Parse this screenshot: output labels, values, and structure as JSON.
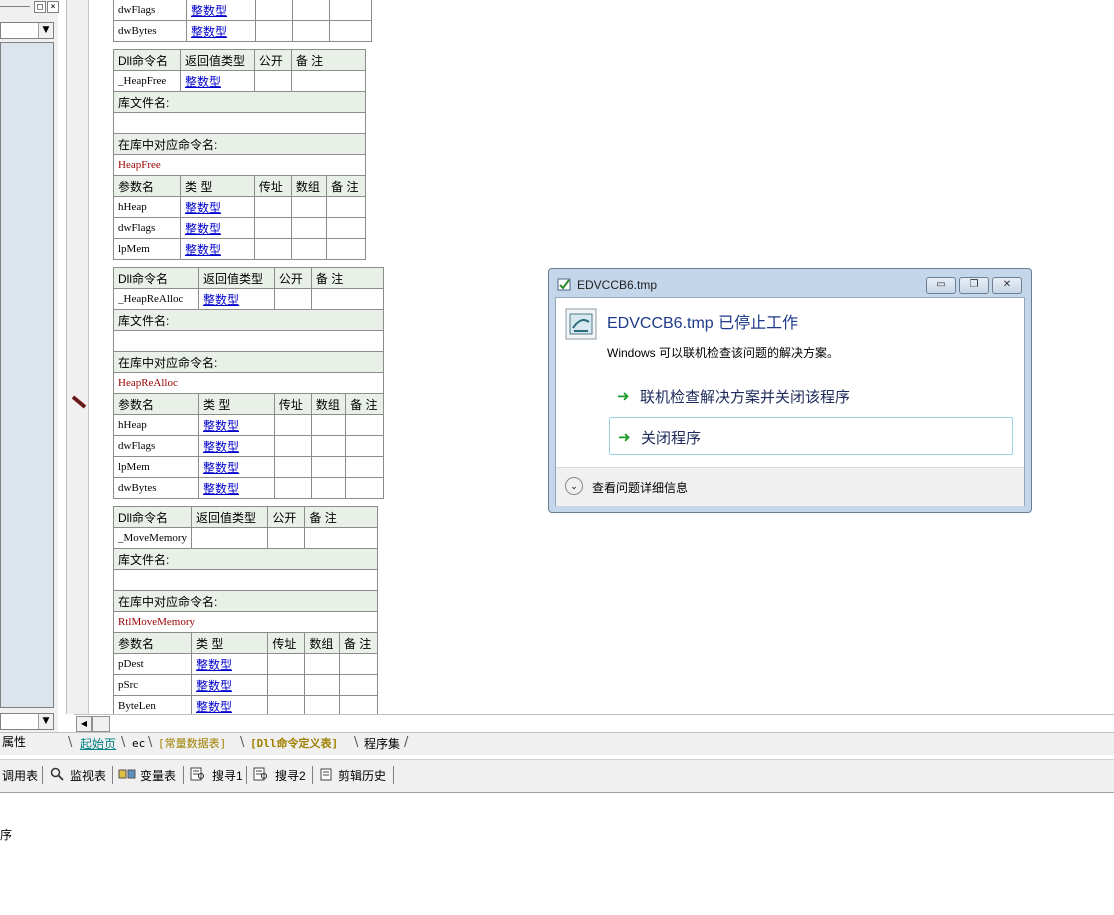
{
  "left": {
    "tab_label": "属性",
    "close_glyph": "×",
    "max_glyph": "□",
    "arrow": "▼"
  },
  "tables": {
    "top_rows": [
      {
        "name": "dwFlags",
        "type": "整数型"
      },
      {
        "name": "dwBytes",
        "type": "整数型"
      }
    ],
    "t1": {
      "h1": "Dll命令名",
      "h2": "返回值类型",
      "h3": "公开",
      "h4": "备 注",
      "cmd": "_HeapFree",
      "ret": "整数型",
      "lib_label": "库文件名:",
      "entry_label": "在库中对应命令名:",
      "entry": "HeapFree",
      "p1": "参数名",
      "p2": "类 型",
      "p3": "传址",
      "p4": "数组",
      "p5": "备 注",
      "params": [
        {
          "name": "hHeap",
          "type": "整数型"
        },
        {
          "name": "dwFlags",
          "type": "整数型"
        },
        {
          "name": "lpMem",
          "type": "整数型"
        }
      ]
    },
    "t2": {
      "h1": "Dll命令名",
      "h2": "返回值类型",
      "h3": "公开",
      "h4": "备 注",
      "cmd": "_HeapReAlloc",
      "ret": "整数型",
      "lib_label": "库文件名:",
      "entry_label": "在库中对应命令名:",
      "entry": "HeapReAlloc",
      "p1": "参数名",
      "p2": "类 型",
      "p3": "传址",
      "p4": "数组",
      "p5": "备 注",
      "params": [
        {
          "name": "hHeap",
          "type": "整数型"
        },
        {
          "name": "dwFlags",
          "type": "整数型"
        },
        {
          "name": "lpMem",
          "type": "整数型"
        },
        {
          "name": "dwBytes",
          "type": "整数型"
        }
      ]
    },
    "t3": {
      "h1": "Dll命令名",
      "h2": "返回值类型",
      "h3": "公开",
      "h4": "备 注",
      "cmd": "_MoveMemory",
      "ret": "",
      "lib_label": "库文件名:",
      "entry_label": "在库中对应命令名:",
      "entry": "RtlMoveMemory",
      "p1": "参数名",
      "p2": "类 型",
      "p3": "传址",
      "p4": "数组",
      "p5": "备 注",
      "params": [
        {
          "name": "pDest",
          "type": "整数型"
        },
        {
          "name": "pSrc",
          "type": "整数型"
        },
        {
          "name": "ByteLen",
          "type": "整数型"
        }
      ]
    }
  },
  "tabs": {
    "t1": "起始页",
    "t2": "ec",
    "t3": "[常量数据表]",
    "t4": "[Dll命令定义表]",
    "t5": "程序集"
  },
  "toolbar": {
    "b1": "调用表",
    "b2": "监视表",
    "b3": "变量表",
    "b4": "搜寻1",
    "b5": "搜寻2",
    "b6": "剪辑历史"
  },
  "output": {
    "text": "序"
  },
  "dialog": {
    "title": "EDVCCB6.tmp",
    "heading": "EDVCCB6.tmp 已停止工作",
    "subtext": "Windows 可以联机检查该问题的解决方案。",
    "option1": "联机检查解决方案并关闭该程序",
    "option2": "关闭程序",
    "details": "查看问题详细信息",
    "min_glyph": "▭",
    "restore_glyph": "❐",
    "close_glyph": "✕",
    "arrow_glyph": "➜",
    "chevron_glyph": "⌄"
  }
}
